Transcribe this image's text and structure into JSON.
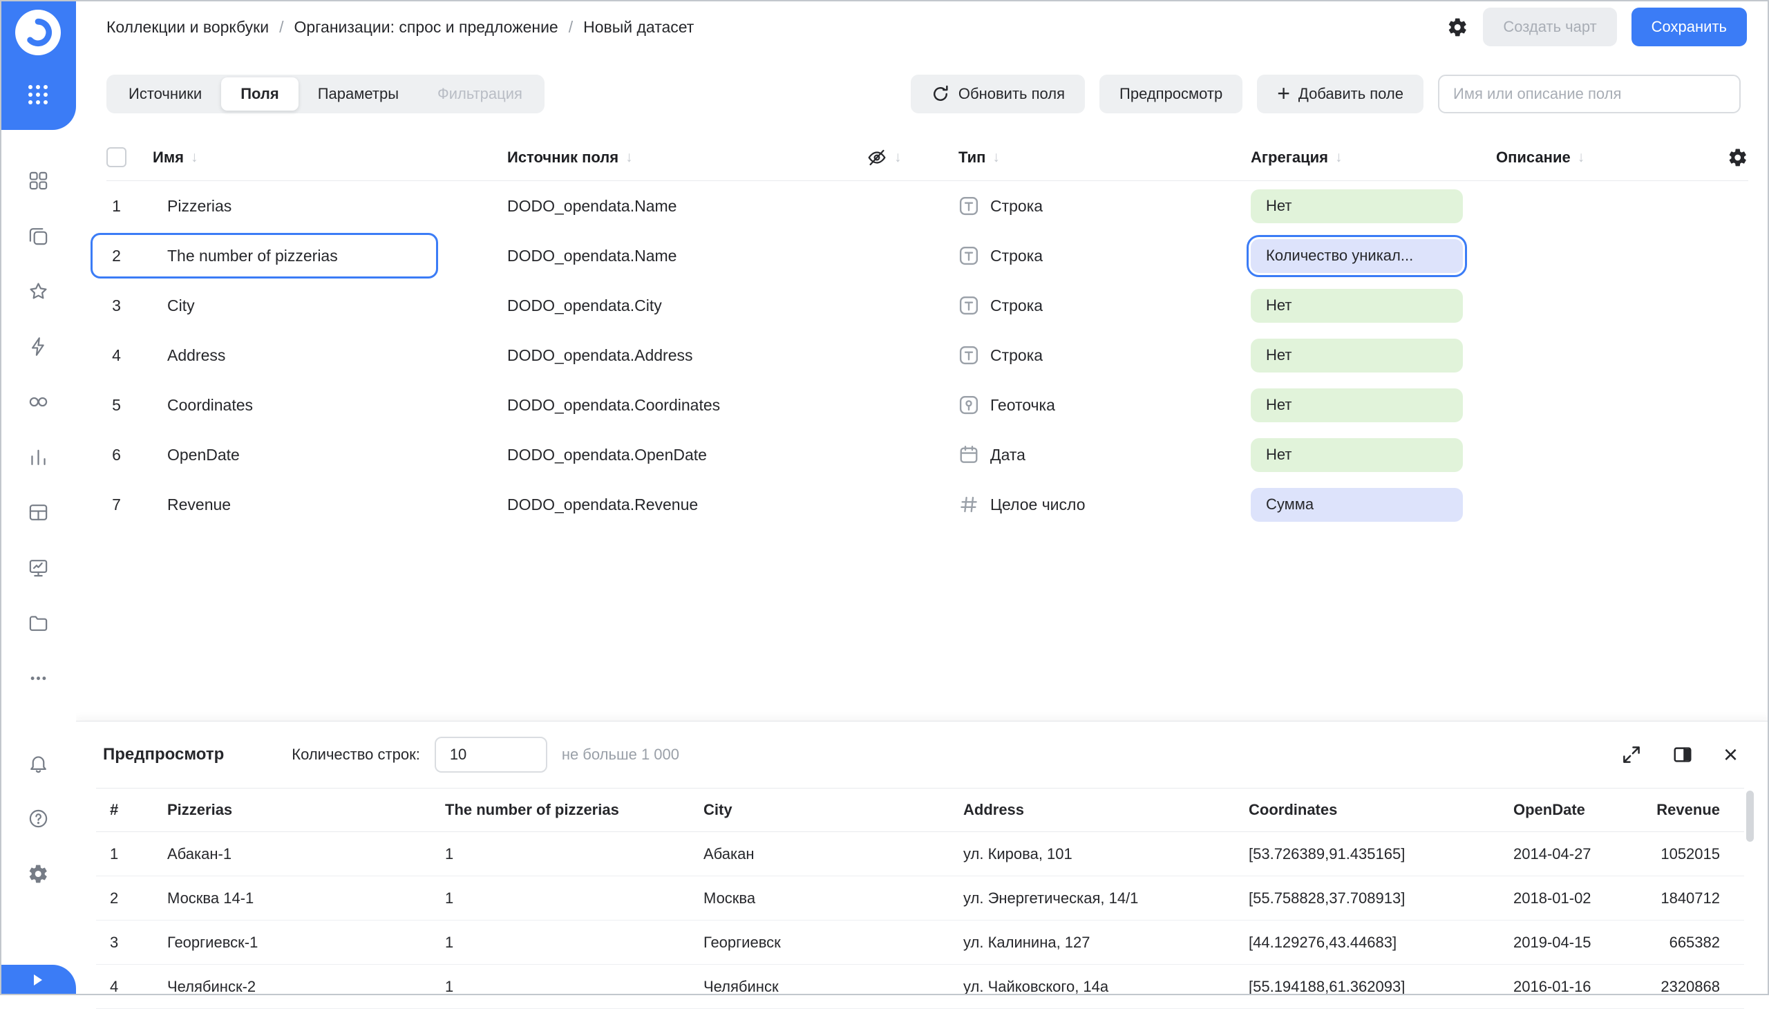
{
  "icons": {
    "sort_desc": "↓",
    "plus": "+",
    "close": "×"
  },
  "header": {
    "breadcrumbs": [
      "Коллекции и воркбуки",
      "Организации: спрос и предложение",
      "Новый датасет"
    ],
    "create_chart_label": "Создать чарт",
    "save_label": "Сохранить"
  },
  "toolbar": {
    "tabs": [
      {
        "label": "Источники",
        "state": "default"
      },
      {
        "label": "Поля",
        "state": "active"
      },
      {
        "label": "Параметры",
        "state": "default"
      },
      {
        "label": "Фильтрация",
        "state": "disabled"
      }
    ],
    "refresh_label": "Обновить поля",
    "preview_label": "Предпросмотр",
    "add_field_label": "Добавить поле",
    "search_placeholder": "Имя или описание поля"
  },
  "fields_table": {
    "columns": {
      "name": "Имя",
      "source": "Источник поля",
      "type": "Тип",
      "aggregation": "Агрегация",
      "description": "Описание"
    },
    "rows": [
      {
        "num": "1",
        "name": "Pizzerias",
        "source": "DODO_opendata.Name",
        "type": "Строка",
        "aggregation": "Нет"
      },
      {
        "num": "2",
        "name": "The number of pizzerias",
        "source": "DODO_opendata.Name",
        "type": "Строка",
        "aggregation": "Количество уникал..."
      },
      {
        "num": "3",
        "name": "City",
        "source": "DODO_opendata.City",
        "type": "Строка",
        "aggregation": "Нет"
      },
      {
        "num": "4",
        "name": "Address",
        "source": "DODO_opendata.Address",
        "type": "Строка",
        "aggregation": "Нет"
      },
      {
        "num": "5",
        "name": "Coordinates",
        "source": "DODO_opendata.Coordinates",
        "type": "Геоточка",
        "aggregation": "Нет"
      },
      {
        "num": "6",
        "name": "OpenDate",
        "source": "DODO_opendata.OpenDate",
        "type": "Дата",
        "aggregation": "Нет"
      },
      {
        "num": "7",
        "name": "Revenue",
        "source": "DODO_opendata.Revenue",
        "type": "Целое число",
        "aggregation": "Сумма"
      }
    ]
  },
  "preview": {
    "title": "Предпросмотр",
    "rows_label": "Количество строк:",
    "rows_value": "10",
    "rows_hint": "не больше 1 000",
    "table": {
      "columns": [
        "#",
        "Pizzerias",
        "The number of pizzerias",
        "City",
        "Address",
        "Coordinates",
        "OpenDate",
        "Revenue"
      ],
      "rows": [
        [
          "1",
          "Абакан-1",
          "1",
          "Абакан",
          "ул. Кирова, 101",
          "[53.726389,91.435165]",
          "2014-04-27",
          "1052015"
        ],
        [
          "2",
          "Москва 14-1",
          "1",
          "Москва",
          "ул. Энергетическая, 14/1",
          "[55.758828,37.708913]",
          "2018-01-02",
          "1840712"
        ],
        [
          "3",
          "Георгиевск-1",
          "1",
          "Георгиевск",
          "ул. Калинина, 127",
          "[44.129276,43.44683]",
          "2019-04-15",
          "665382"
        ],
        [
          "4",
          "Челябинск-2",
          "1",
          "Челябинск",
          "ул. Чайковского, 14а",
          "[55.194188,61.362093]",
          "2016-01-16",
          "2320868"
        ]
      ]
    }
  },
  "colors": {
    "accent": "#3b7cf6",
    "aggregation_none_bg": "#e1f3da",
    "aggregation_set_bg": "#dde3fb"
  }
}
